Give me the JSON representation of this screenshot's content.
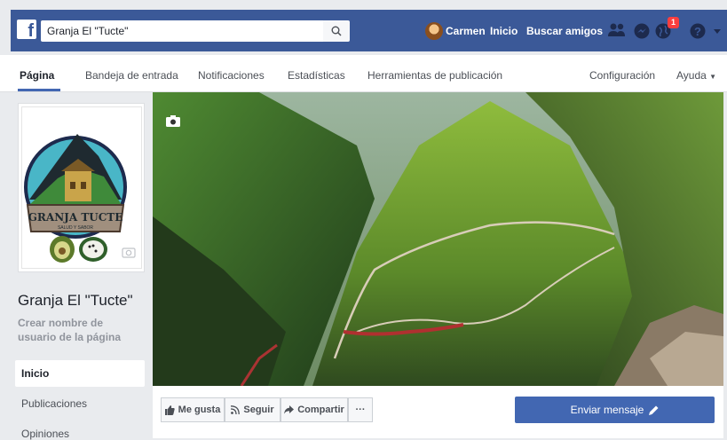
{
  "search": {
    "value": "Granja El \"Tucte\""
  },
  "topbar": {
    "user_name": "Carmen",
    "inicio": "Inicio",
    "find_friends": "Buscar amigos",
    "notification_count": "1"
  },
  "page_nav": {
    "tabs": [
      {
        "label": "Página"
      },
      {
        "label": "Bandeja de entrada"
      },
      {
        "label": "Notificaciones"
      },
      {
        "label": "Estadísticas"
      },
      {
        "label": "Herramientas de publicación"
      }
    ],
    "settings": "Configuración",
    "help": "Ayuda"
  },
  "profile": {
    "logo_text": "GRANJA TUCTE",
    "logo_subtext": "SALUD Y SABOR",
    "page_name": "Granja El \"Tucte\"",
    "username_prompt": "Crear nombre de usuario de la página"
  },
  "left_nav": {
    "items": [
      {
        "label": "Inicio"
      },
      {
        "label": "Publicaciones"
      },
      {
        "label": "Opiniones"
      }
    ]
  },
  "actions": {
    "like": "Me gusta",
    "follow": "Seguir",
    "share": "Compartir",
    "more": "···",
    "send_message": "Enviar mensaje"
  },
  "colors": {
    "brand_blue": "#3b5998",
    "button_blue": "#4267b2",
    "badge_red": "#fa3e3e"
  }
}
